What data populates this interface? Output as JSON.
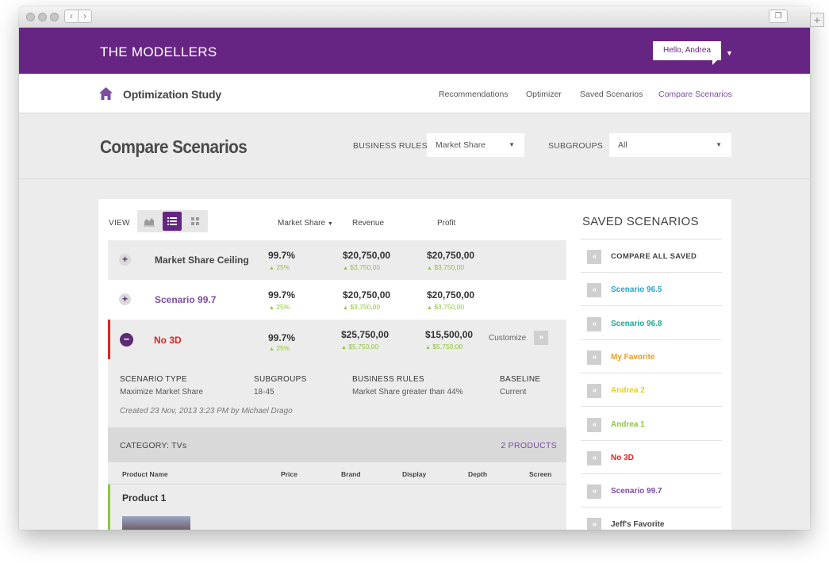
{
  "app": {
    "brand": "THE MODELLERS",
    "greeting": "Hello, Andrea",
    "study_title": "Optimization Study",
    "nav": [
      "Recommendations",
      "Optimizer",
      "Saved Scenarios",
      "Compare Scenarios"
    ],
    "active_nav": "Compare Scenarios"
  },
  "page": {
    "title": "Compare Scenarios",
    "business_rules_label": "BUSINESS RULES",
    "business_rules_value": "Market Share",
    "subgroups_label": "SUBGROUPS",
    "subgroups_value": "All"
  },
  "table": {
    "view_label": "VIEW",
    "columns": [
      "Market Share",
      "Revenue",
      "Profit"
    ],
    "rows": [
      {
        "name": "Market Share Ceiling",
        "market_share": "99.7%",
        "ms_delta": "25%",
        "revenue": "$20,750,00",
        "rev_delta": "$3,750,00",
        "profit": "$20,750,00",
        "profit_delta": "$3,750,00"
      },
      {
        "name": "Scenario 99.7",
        "market_share": "99.7%",
        "ms_delta": "25%",
        "revenue": "$20,750,00",
        "rev_delta": "$3,750,00",
        "profit": "$20,750,00",
        "profit_delta": "$3,750,00"
      },
      {
        "name": "No 3D",
        "market_share": "99.7%",
        "ms_delta": "25%",
        "revenue": "$25,750,00",
        "rev_delta": "$5,750,00",
        "profit": "$15,500,00",
        "profit_delta": "$5,750,00"
      }
    ],
    "customize_label": "Customize"
  },
  "details": {
    "scenario_type_label": "SCENARIO TYPE",
    "scenario_type_value": "Maximize Market Share",
    "subgroups_label": "SUBGROUPS",
    "subgroups_value": "18-45",
    "business_rules_label": "BUSINESS RULES",
    "business_rules_value": "Market Share greater than 44%",
    "baseline_label": "BASELINE",
    "baseline_value": "Current",
    "created": "Created 23 Nov, 2013 3:23 PM by Michael Drago"
  },
  "category": {
    "label": "CATEGORY: TVs",
    "count": "2 PRODUCTS",
    "columns": [
      "Product Name",
      "Price",
      "Brand",
      "Display",
      "Depth",
      "Screen"
    ],
    "products": [
      {
        "name": "Product 1"
      }
    ]
  },
  "saved": {
    "title": "SAVED SCENARIOS",
    "compare_all": "COMPARE ALL SAVED",
    "items": [
      {
        "name": "Scenario 96.5",
        "color": "#2aa3c9"
      },
      {
        "name": "Scenario 96.8",
        "color": "#1fa89a"
      },
      {
        "name": "My Favorite",
        "color": "#f09a1c"
      },
      {
        "name": "Andrea 2",
        "color": "#e8d01e"
      },
      {
        "name": "Andrea 1",
        "color": "#8dc63f"
      },
      {
        "name": "No 3D",
        "color": "#e02222"
      },
      {
        "name": "Scenario 99.7",
        "color": "#7b4ea0"
      },
      {
        "name": "Jeff's Favorite",
        "color": "#444444"
      }
    ]
  },
  "colors": {
    "brand_purple": "#672583",
    "link_purple": "#7b4ea0",
    "positive_green": "#8dc63f",
    "alert_red": "#e02222"
  }
}
